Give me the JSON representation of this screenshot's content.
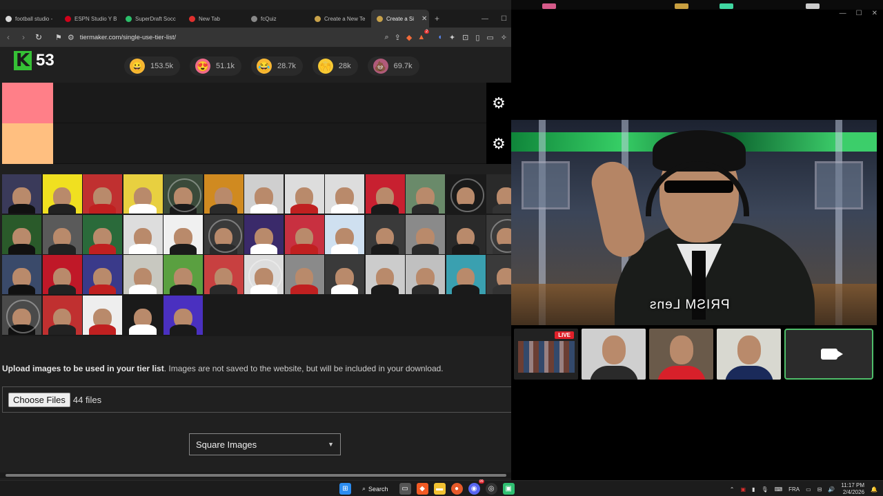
{
  "browser": {
    "tabs": [
      {
        "label": "football studio -",
        "color": "#d9d9d9"
      },
      {
        "label": "ESPN Studio Y B",
        "color": "#d0021b"
      },
      {
        "label": "SuperDraft Socc",
        "color": "#2bbf6a"
      },
      {
        "label": "New Tab",
        "color": "#e0302e"
      },
      {
        "label": "fcQuiz",
        "color": "#888888"
      },
      {
        "label": "Create a New Te",
        "color": "#c8a24a"
      },
      {
        "label": "Create a Si",
        "color": "#c8a24a",
        "active": true
      }
    ],
    "new_tab_label": "+",
    "url": "tiermaker.com/single-use-tier-list/",
    "brave_badge_count": "2"
  },
  "site": {
    "brand_number": "53",
    "reactions": [
      {
        "emoji": "😀",
        "count": "153.5k",
        "color": "#f7b733"
      },
      {
        "emoji": "😍",
        "count": "51.1k",
        "color": "#f06a8a"
      },
      {
        "emoji": "😂",
        "count": "28.7k",
        "color": "#f7b733"
      },
      {
        "emoji": "🙌",
        "count": "28k",
        "color": "#f7c933"
      },
      {
        "emoji": "💩",
        "count": "69.7k",
        "color": "#b05a7a"
      }
    ],
    "tiers": [
      {
        "color": "#ff7f88"
      },
      {
        "color": "#ffbf80"
      }
    ],
    "upload_bold": "Upload images to be used in your tier list",
    "upload_rest": ". Images are not saved to the website, but will be included in your download.",
    "choose_files_label": "Choose Files",
    "files_count": "44 files",
    "image_shape": "Square Images"
  },
  "call": {
    "watermark": "PRISM Lens",
    "live_label": "LIVE"
  },
  "taskbar": {
    "search_label": "Search",
    "language": "FRA",
    "time": "11:17 PM",
    "date": "2/4/2026",
    "notification_badge": "99"
  }
}
